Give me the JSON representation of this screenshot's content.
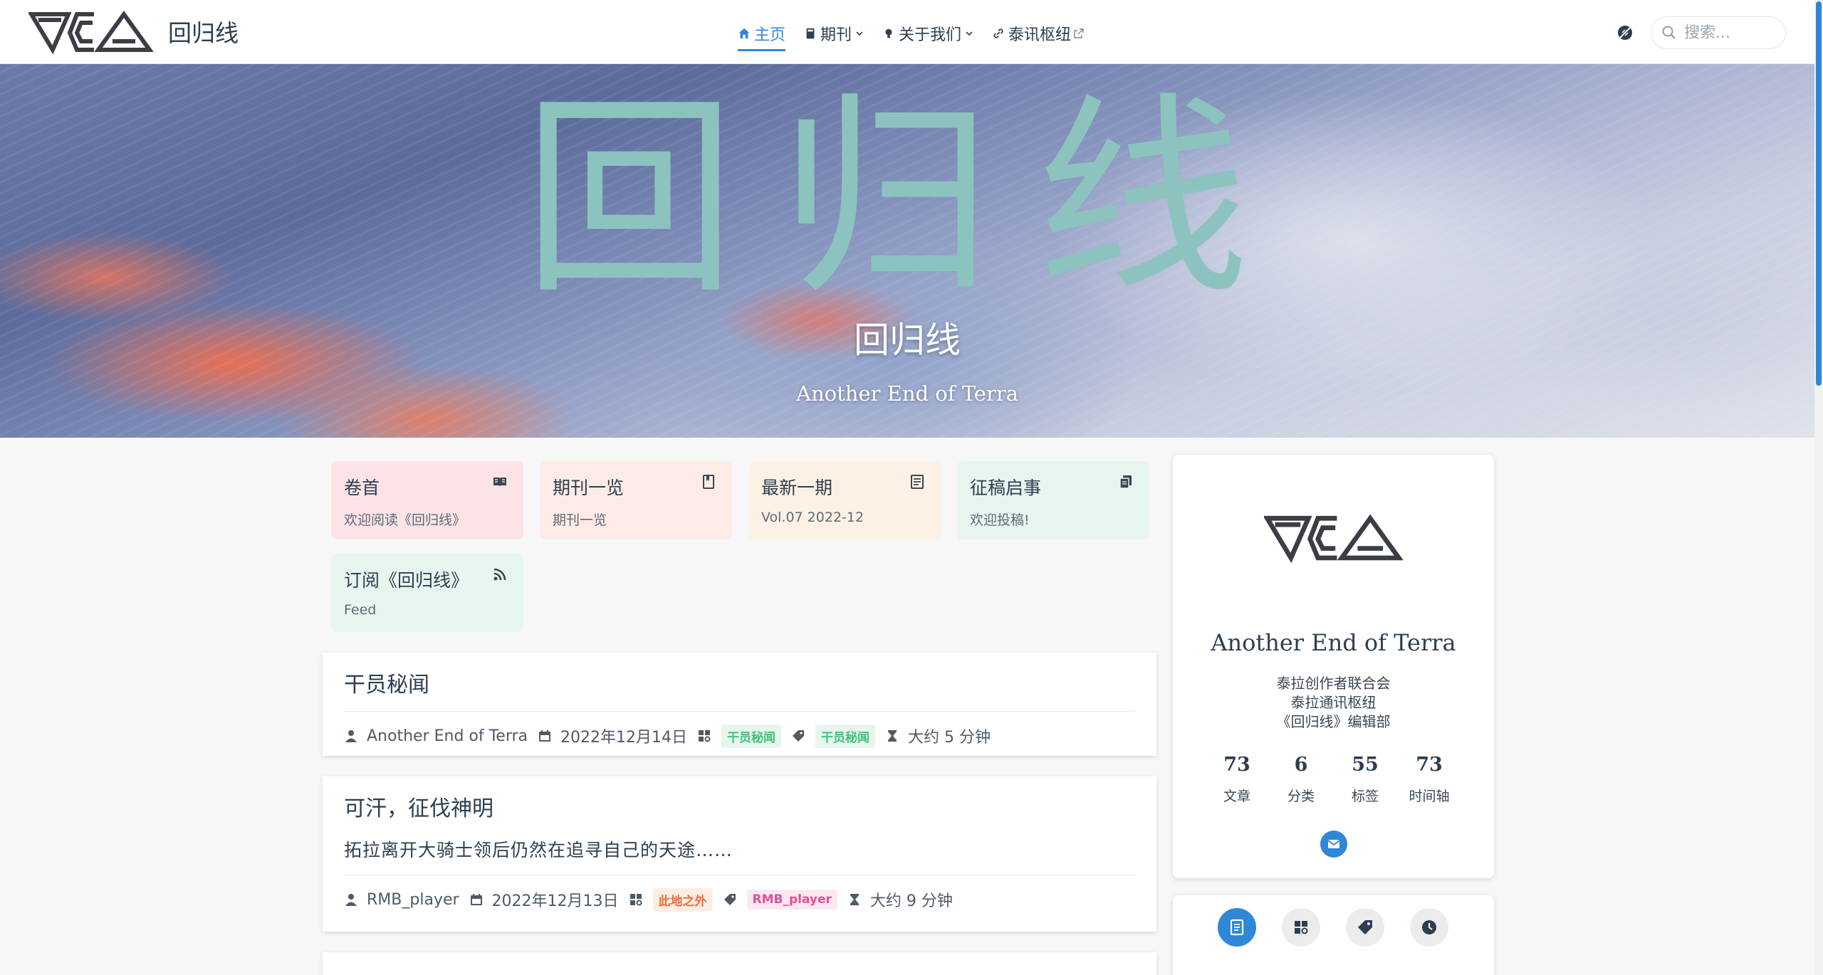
{
  "site": {
    "title": "回归线"
  },
  "nav": {
    "items": [
      {
        "label": "主页",
        "icon": "home-icon"
      },
      {
        "label": "期刊",
        "icon": "book-icon"
      },
      {
        "label": "关于我们",
        "icon": "bulb-icon"
      },
      {
        "label": "泰讯枢纽",
        "icon": "link-icon"
      }
    ],
    "search_placeholder": "搜索..."
  },
  "hero": {
    "big_text": "回归线",
    "title": "回归线",
    "subtitle": "Another End of Terra"
  },
  "projects": [
    {
      "name": "卷首",
      "desc": "欢迎阅读《回归线》",
      "icon": "book-open-icon",
      "color": "#fde3e6"
    },
    {
      "name": "期刊一览",
      "desc": "期刊一览",
      "icon": "bookmark-book-icon",
      "color": "#fdece6"
    },
    {
      "name": "最新一期",
      "desc": "Vol.07 2022-12",
      "icon": "article-icon",
      "color": "#fdf1e6"
    },
    {
      "name": "征稿启事",
      "desc": "欢迎投稿!",
      "icon": "copy-docs-icon",
      "color": "#e6f6ee"
    },
    {
      "name": "订阅《回归线》",
      "desc": "Feed",
      "icon": "rss-icon",
      "color": "#e6f6ee"
    }
  ],
  "articles": [
    {
      "title": "干员秘闻",
      "excerpt": "",
      "author": "Another End of Terra",
      "date": "2022年12月14日",
      "category": "干员秘闻",
      "tag": "干员秘闻",
      "reading_time": "大约 5 分钟"
    },
    {
      "title": "可汗，征伐神明",
      "excerpt": "拓拉离开大骑士领后仍然在追寻自己的天途……",
      "author": "RMB_player",
      "date": "2022年12月13日",
      "category": "此地之外",
      "tag": "RMB_player",
      "reading_time": "大约 9 分钟"
    }
  ],
  "blogger": {
    "name": "Another End of Terra",
    "desc_lines": [
      "泰拉创作者联合会",
      "泰拉通讯枢纽",
      "《回归线》编辑部"
    ],
    "stats": [
      {
        "value": "73",
        "label": "文章"
      },
      {
        "value": "6",
        "label": "分类"
      },
      {
        "value": "55",
        "label": "标签"
      },
      {
        "value": "73",
        "label": "时间轴"
      }
    ]
  },
  "info_switch": [
    "article-list-icon",
    "category-icon",
    "tag-icon",
    "timeline-icon"
  ],
  "colors": {
    "accent": "#2f87d8",
    "hero_text": "#8cc3be"
  }
}
